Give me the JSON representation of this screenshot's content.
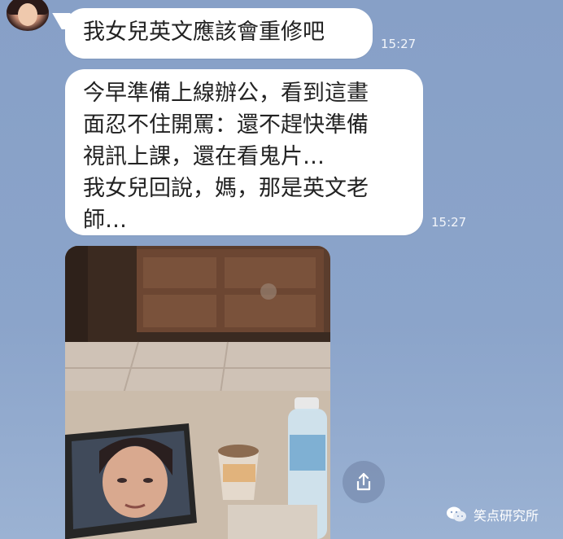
{
  "chat": {
    "messages": [
      {
        "text": "我女兒英文應該會重修吧",
        "time": "15:27"
      },
      {
        "lines": [
          "今早準備上線辦公，看到這畫",
          "面忍不住開罵：還不趕快準備",
          "視訊上課，還在看鬼片…",
          "我女兒回說，媽，那是英文老",
          "師…"
        ],
        "time": "15:27"
      }
    ]
  },
  "share": {
    "icon": "share-icon"
  },
  "watermark": {
    "text": "笑点研究所",
    "icon": "wechat-icon"
  },
  "colors": {
    "background": "#8aa3c8",
    "bubble": "#ffffff",
    "time_text": "#f2f5fa"
  }
}
